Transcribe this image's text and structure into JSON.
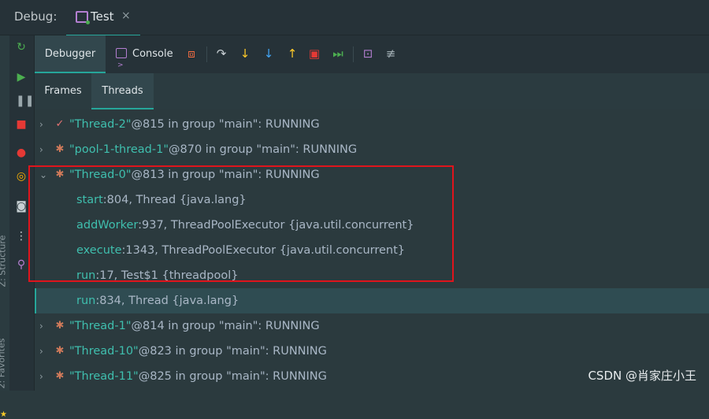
{
  "titlebar": {
    "label": "Debug:",
    "tab": "Test",
    "close": "×"
  },
  "left_bar": {
    "structure": "Z: Structure",
    "favorites": "2: Favorites"
  },
  "toolbar": {
    "debugger": "Debugger",
    "console": "Console"
  },
  "subtabs": {
    "frames": "Frames",
    "threads": "Threads"
  },
  "threads": [
    {
      "name": "\"Thread-2\"",
      "rest": "@815 in group \"main\": RUNNING",
      "chev": "›"
    },
    {
      "name": "\"pool-1-thread-1\"",
      "rest": "@870 in group \"main\": RUNNING",
      "chev": "›"
    },
    {
      "name": "\"Thread-0\"",
      "rest": "@813 in group \"main\": RUNNING",
      "chev": "⌄"
    },
    {
      "name": "\"Thread-1\"",
      "rest": "@814 in group \"main\": RUNNING",
      "chev": "›"
    },
    {
      "name": "\"Thread-10\"",
      "rest": "@823 in group \"main\": RUNNING",
      "chev": "›"
    },
    {
      "name": "\"Thread-11\"",
      "rest": "@825 in group \"main\": RUNNING",
      "chev": "›"
    }
  ],
  "frames": [
    {
      "method": "start",
      "rest": ":804, Thread {java.lang}"
    },
    {
      "method": "addWorker",
      "rest": ":937, ThreadPoolExecutor {java.util.concurrent}"
    },
    {
      "method": "execute",
      "rest": ":1343, ThreadPoolExecutor {java.util.concurrent}"
    },
    {
      "method": "run",
      "rest": ":17, Test$1 {threadpool}"
    },
    {
      "method": "run",
      "rest": ":834, Thread {java.lang}"
    }
  ],
  "watermark": "CSDN @肖家庄小王",
  "colors": {
    "accent": "#26a69a",
    "highlight": "#e0141c",
    "thread_name": "#3fbfae"
  }
}
